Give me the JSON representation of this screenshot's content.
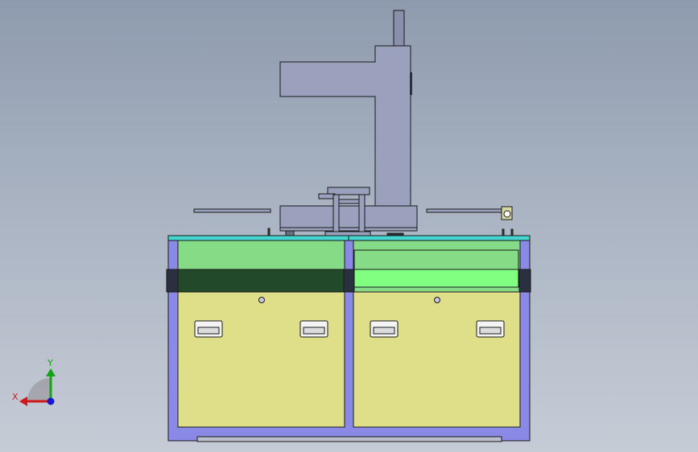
{
  "view": {
    "colors": {
      "bg_top": "#8e9bae",
      "bg_bottom": "#c6ccd6",
      "frame": "#8080e0",
      "top_plate": "#40d0cc",
      "tray_light": "#86dc86",
      "tray_dark": "#22492a",
      "tray_green": "#80ff80",
      "panel": "#dfdf8a",
      "column": "#9aa0bc",
      "band": "#2a3040"
    }
  },
  "triad": {
    "x_label": "X",
    "y_label": "Y",
    "x_color": "#d01818",
    "y_color": "#18a018",
    "z_color": "#1818d0"
  }
}
